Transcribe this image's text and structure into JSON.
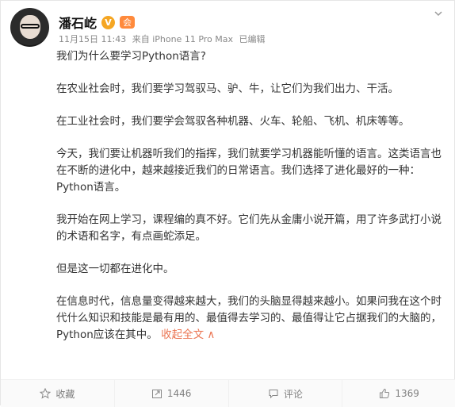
{
  "post": {
    "author": "潘石屹",
    "verified_badge": "V",
    "member_badge": "会",
    "timestamp": "11月15日 11:43",
    "source": "来自 iPhone 11 Pro Max",
    "edited": "已编辑",
    "paragraphs": [
      "我们为什么要学习Python语言?",
      "在农业社会时，我们要学习驾驭马、驴、牛，让它们为我们出力、干活。",
      "在工业社会时，我们要学会驾驭各种机器、火车、轮船、飞机、机床等等。",
      "今天，我们要让机器听我们的指挥，我们就要学习机器能听懂的语言。这类语言也在不断的进化中，越来越接近我们的日常语言。我们选择了进化最好的一种：Python语言。",
      "我开始在网上学习，课程编的真不好。它们先从金庸小说开篇，用了许多武打小说的术语和名字，有点画蛇添足。",
      "但是这一切都在进化中。",
      "在信息时代，信息量变得越来越大，我们的头脑显得越来越小。如果问我在这个时代什么知识和技能是最有用的、最值得去学习的、最值得让它占据我们的大脑的，Python应该在其中。"
    ],
    "collapse_label": "收起全文 ∧"
  },
  "actions": {
    "favorite": "收藏",
    "repost": "1446",
    "comment": "评论",
    "like": "1369"
  },
  "colors": {
    "link": "#eb7350",
    "meta": "#888888"
  }
}
